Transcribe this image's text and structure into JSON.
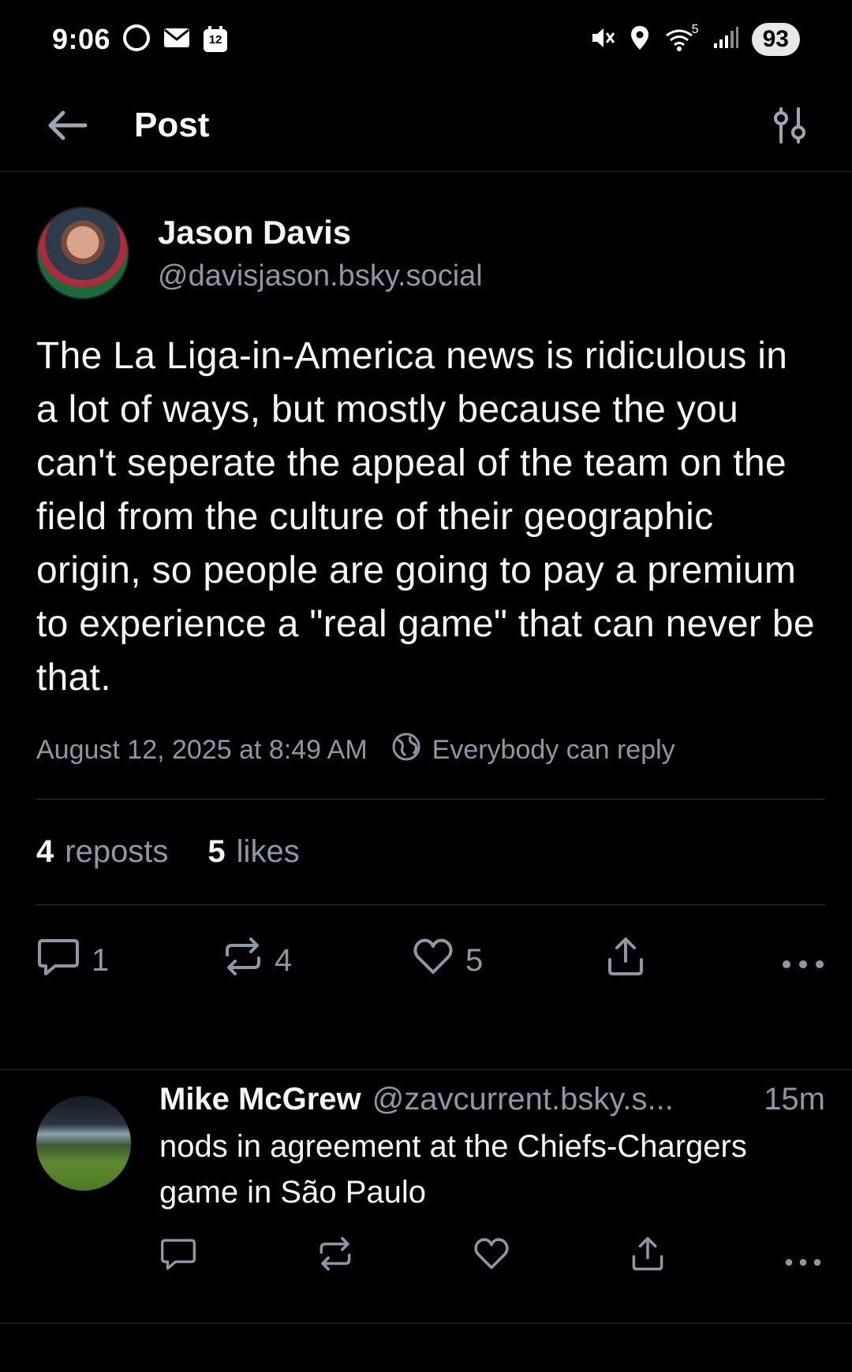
{
  "status_bar": {
    "time": "9:06",
    "calendar_day": "12",
    "network": "5",
    "battery": "93"
  },
  "header": {
    "title": "Post"
  },
  "post": {
    "author_name": "Jason Davis",
    "author_handle": "@davisjason.bsky.social",
    "text": "The La Liga-in-America news is ridiculous in a lot of ways, but mostly because the you can't seperate the appeal of the team on the field from the culture of their geographic origin, so people are going to pay a premium to experience a \"real game\" that can never be that.",
    "timestamp": "August 12, 2025 at 8:49 AM",
    "reply_setting": "Everybody can reply",
    "reposts_count": "4",
    "reposts_label": "reposts",
    "likes_count": "5",
    "likes_label": "likes",
    "actions": {
      "replies": "1",
      "reposts": "4",
      "likes": "5"
    }
  },
  "reply": {
    "author_name": "Mike McGrew",
    "author_handle": "@zavcurrent.bsky.s...",
    "time": "15m",
    "text": "nods in agreement at the Chiefs-Chargers game in São Paulo"
  },
  "colors": {
    "background": "#000000",
    "text": "#f4f6f8",
    "muted": "#8b98a5",
    "divider": "#2a323b"
  }
}
